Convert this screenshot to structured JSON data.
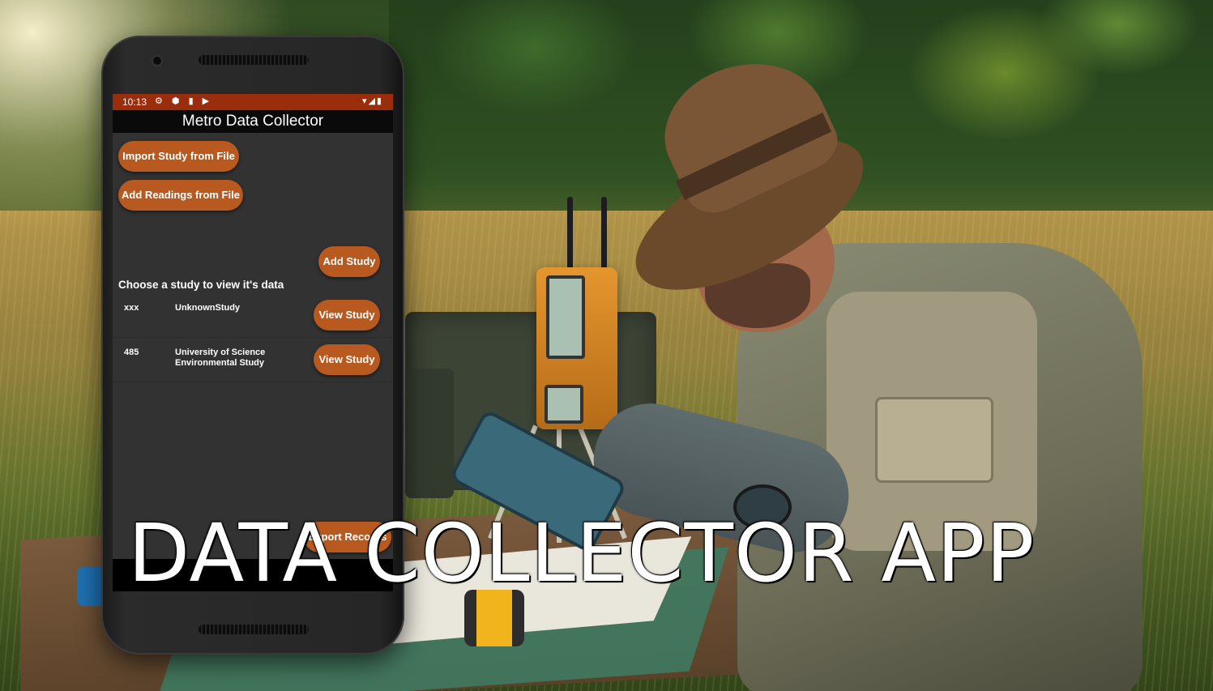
{
  "phone": {
    "status": {
      "time": "10:13",
      "left_icons": "⚙ ⬢ ▮ ▶",
      "right_icons": "▾◢▮"
    },
    "app_title": "Metro Data Collector",
    "buttons": {
      "import_study": "Import Study from File",
      "add_readings": "Add Readings from File",
      "add_study": "Add Study",
      "export_records": "Export Records"
    },
    "prompt": "Choose a study to view it's data",
    "studies": [
      {
        "id": "xxx",
        "name": "UnknownStudy",
        "action": "View Study"
      },
      {
        "id": "485",
        "name": "University of Science Environmental Study",
        "action": "View Study"
      }
    ]
  },
  "headline": "DATA COLLECTOR APP",
  "colors": {
    "status_bar": "#9a2d0c",
    "button": "#b85a1f",
    "screen_bg": "#323232",
    "app_bar": "#0a0a0a"
  }
}
